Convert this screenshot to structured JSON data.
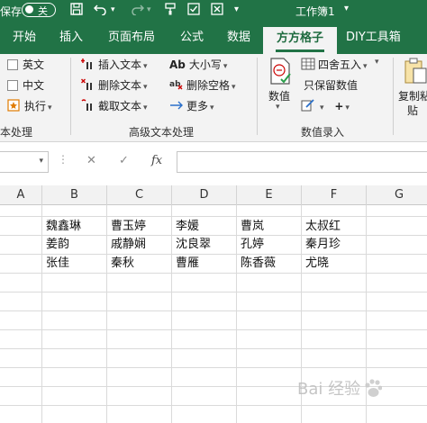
{
  "titlebar": {
    "autosave_label": "保存",
    "autosave_state": "关",
    "doc_title": "工作簿1",
    "dropdown_glyph": "▾",
    "icons": [
      "save-icon",
      "undo-icon",
      "redo-icon",
      "format-painter-icon",
      "checkbox-icon",
      "close-box-icon"
    ]
  },
  "tabs": [
    {
      "label": "开始"
    },
    {
      "label": "插入"
    },
    {
      "label": "页面布局"
    },
    {
      "label": "公式"
    },
    {
      "label": "数据"
    },
    {
      "label": "方方格子",
      "active": true
    },
    {
      "label": "DIY工具箱"
    }
  ],
  "ribbon": {
    "text_group": {
      "label": "本处理",
      "items": [
        "英文",
        "中文",
        "执行"
      ]
    },
    "advanced_text_group": {
      "label": "高级文本处理",
      "items": [
        "插入文本",
        "删除文本",
        "截取文本",
        "大小写",
        "删除空格",
        "更多"
      ],
      "ab_glyph": "Ab",
      "abc_glyph": "Abc"
    },
    "numeric_group": {
      "label": "数值录入",
      "big_button": "数值",
      "items": [
        "四舍五入",
        "只保留数值"
      ],
      "plus_glyph": "+"
    },
    "copy_group": {
      "line1": "复制粘",
      "line2": "贴"
    }
  },
  "formula_bar": {
    "name_box_value": "",
    "cancel_glyph": "✕",
    "confirm_glyph": "✓",
    "fx_label": "fx",
    "formula_value": ""
  },
  "grid": {
    "columns": [
      "A",
      "B",
      "C",
      "D",
      "E",
      "F",
      "G"
    ],
    "rows": [
      [
        "",
        "魏鑫琳",
        "曹玉婷",
        "李媛",
        "曹岚",
        "太叔红"
      ],
      [
        "",
        "姜韵",
        "戚静娴",
        "沈良翠",
        "孔婷",
        "秦月珍"
      ],
      [
        "",
        "张佳",
        "秦秋",
        "曹雁",
        "陈香薇",
        "尤晓"
      ]
    ]
  },
  "watermark": {
    "text": "Bai  经验"
  },
  "colors": {
    "excel_green": "#217346",
    "ribbon_bg": "#f3f3f3",
    "grid_line": "#dadada"
  }
}
